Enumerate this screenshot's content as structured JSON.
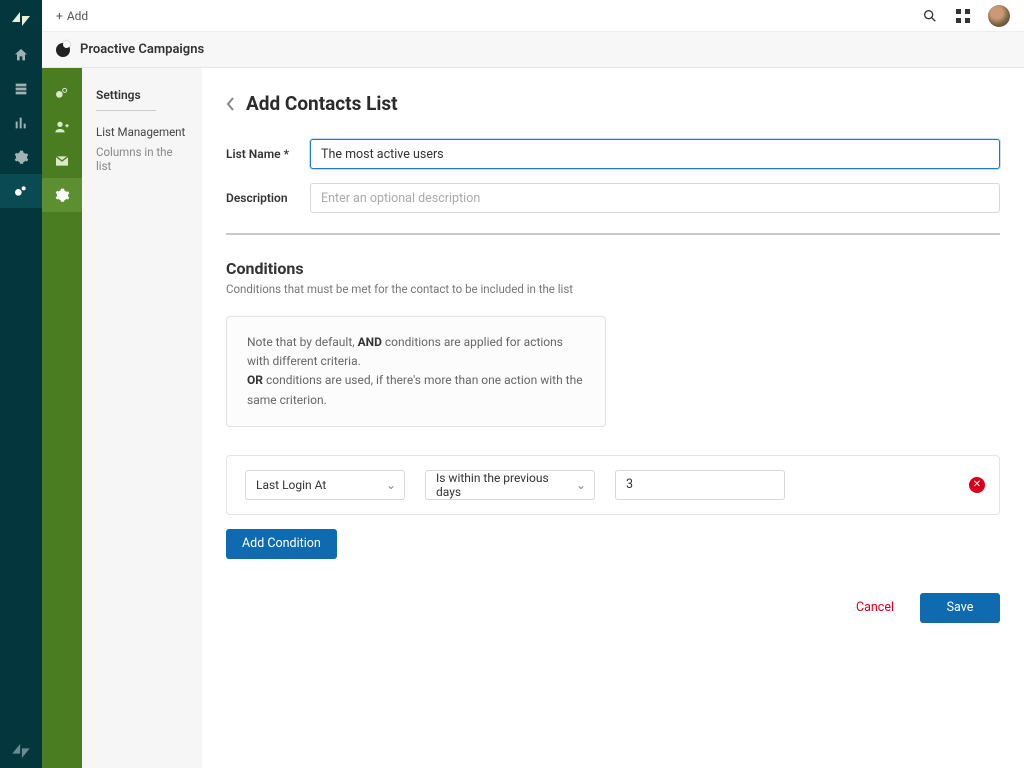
{
  "topbar": {
    "add_label": "Add"
  },
  "app_header": {
    "title": "Proactive Campaigns"
  },
  "sidebar": {
    "title": "Settings",
    "links": [
      {
        "label": "List Management"
      },
      {
        "label": "Columns in the list"
      }
    ]
  },
  "page": {
    "title": "Add Contacts List",
    "fields": {
      "list_name": {
        "label": "List Name *",
        "value": "The most active users",
        "placeholder": ""
      },
      "description": {
        "label": "Description",
        "value": "",
        "placeholder": "Enter an optional description"
      }
    },
    "conditions": {
      "title": "Conditions",
      "subtitle": "Conditions that must be met for the contact to be included in the list",
      "note_pre": "Note that by default, ",
      "note_and": "AND",
      "note_and_cont": " conditions are applied for actions with different criteria.",
      "note_or": "OR",
      "note_or_cont": " conditions are used, if there's more than one action with the same criterion.",
      "rows": [
        {
          "field": "Last Login At",
          "operator": "Is within the previous days",
          "value": "3"
        }
      ],
      "add_label": "Add Condition"
    },
    "actions": {
      "cancel": "Cancel",
      "save": "Save"
    }
  }
}
